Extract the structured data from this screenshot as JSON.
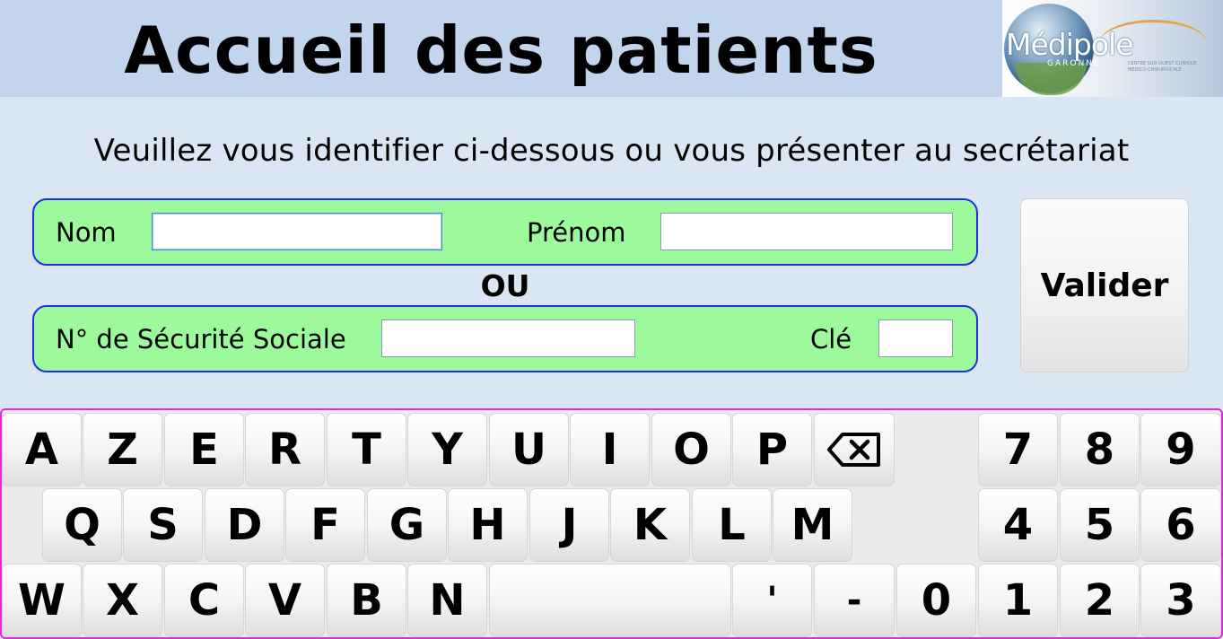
{
  "header": {
    "title": "Accueil des patients",
    "logo": {
      "name": "Médipole",
      "subtitle": "GARONNE",
      "tagline": "CENTRE SUD-OUEST CLINIQUE MÉDICO-CHIRURGICALE"
    }
  },
  "instructions": "Veuillez vous identifier ci-dessous ou vous présenter au secrétariat",
  "form": {
    "nom": {
      "label": "Nom",
      "value": "",
      "placeholder": ""
    },
    "prenom": {
      "label": "Prénom",
      "value": "",
      "placeholder": ""
    },
    "or_label": "OU",
    "ssn": {
      "label": "N° de Sécurité Sociale",
      "value": "",
      "placeholder": ""
    },
    "cle": {
      "label": "Clé",
      "value": "",
      "placeholder": ""
    },
    "validate_label": "Valider"
  },
  "keyboard": {
    "row1": [
      "A",
      "Z",
      "E",
      "R",
      "T",
      "Y",
      "U",
      "I",
      "O",
      "P"
    ],
    "row2": [
      "Q",
      "S",
      "D",
      "F",
      "G",
      "H",
      "J",
      "K",
      "L",
      "M"
    ],
    "row3": [
      "W",
      "X",
      "C",
      "V",
      "B",
      "N"
    ],
    "apostrophe": "'",
    "hyphen": "-",
    "backspace_icon": "backspace-icon",
    "numpad": {
      "row1": [
        "7",
        "8",
        "9"
      ],
      "row2": [
        "4",
        "5",
        "6"
      ],
      "row3": [
        "0",
        "1",
        "2",
        "3"
      ]
    }
  },
  "colors": {
    "header_bg": "#c3d5ec",
    "page_bg": "#dae6f4",
    "field_group_bg": "#9dfa9c",
    "field_group_border": "#1e2ee8",
    "keyboard_border": "#e22be0"
  }
}
